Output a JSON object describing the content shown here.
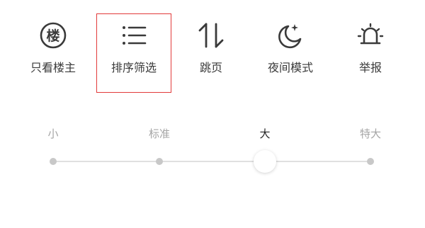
{
  "menu": {
    "items": [
      {
        "label": "只看楼主",
        "icon": "building-circle-icon",
        "icon_glyph": "楼"
      },
      {
        "label": "排序筛选",
        "icon": "sort-filter-list-icon"
      },
      {
        "label": "跳页",
        "icon": "jump-page-arrows-icon"
      },
      {
        "label": "夜间模式",
        "icon": "night-mode-moon-icon"
      },
      {
        "label": "举报",
        "icon": "report-alarm-icon"
      }
    ],
    "highlighted_item": "排序筛选",
    "highlight_color": "#e23a3a"
  },
  "font_size": {
    "options": [
      "小",
      "标准",
      "大",
      "特大"
    ],
    "selected": "大",
    "selected_index": 2
  },
  "colors": {
    "icon": "#3a3a3a",
    "label_inactive": "#a5a5a5",
    "label_active": "#222222",
    "track": "#e0e0e0",
    "dot": "#c8c8c8"
  }
}
